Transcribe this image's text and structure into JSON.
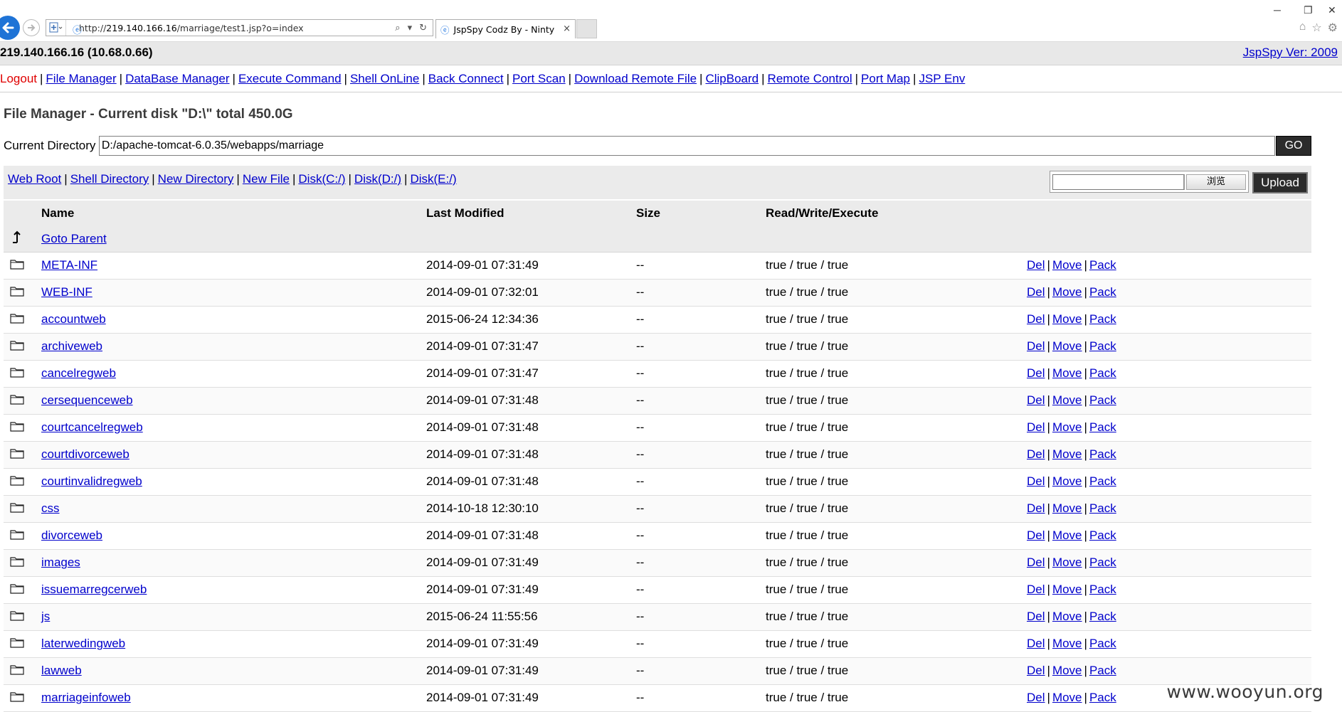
{
  "browser": {
    "url_prefix": "http://",
    "url_host": "219.140.166.16",
    "url_path": "/marriage/test1.jsp?o=index",
    "tab_title": "JspSpy Codz By - Ninty",
    "tab_close": "×"
  },
  "header": {
    "server": "219.140.166.16 (10.68.0.66)",
    "version": "JspSpy Ver: 2009"
  },
  "menu": {
    "logout": "Logout",
    "items": [
      "File Manager",
      "DataBase Manager",
      "Execute Command",
      "Shell OnLine",
      "Back Connect",
      "Port Scan",
      "Download Remote File",
      "ClipBoard",
      "Remote Control",
      "Port Map",
      "JSP Env"
    ]
  },
  "title": "File Manager - Current disk \"D:\\\" total 450.0G",
  "current_directory": {
    "label": "Current Directory",
    "value": "D:/apache-tomcat-6.0.35/webapps/marriage",
    "go_label": "GO"
  },
  "toolbar": {
    "links": [
      "Web Root",
      "Shell Directory",
      "New Directory",
      "New File",
      "Disk(C:/)",
      "Disk(D:/)",
      "Disk(E:/)"
    ],
    "browse_label": "浏览",
    "upload_label": "Upload"
  },
  "table": {
    "headers": {
      "name": "Name",
      "modified": "Last Modified",
      "size": "Size",
      "rwe": "Read/Write/Execute"
    },
    "parent_label": "Goto Parent",
    "actions": [
      "Del",
      "Move",
      "Pack"
    ],
    "rows": [
      {
        "name": "META-INF",
        "modified": "2014-09-01 07:31:49",
        "size": "--",
        "rwe": "true / true / true"
      },
      {
        "name": "WEB-INF",
        "modified": "2014-09-01 07:32:01",
        "size": "--",
        "rwe": "true / true / true"
      },
      {
        "name": "accountweb",
        "modified": "2015-06-24 12:34:36",
        "size": "--",
        "rwe": "true / true / true"
      },
      {
        "name": "archiveweb",
        "modified": "2014-09-01 07:31:47",
        "size": "--",
        "rwe": "true / true / true"
      },
      {
        "name": "cancelregweb",
        "modified": "2014-09-01 07:31:47",
        "size": "--",
        "rwe": "true / true / true"
      },
      {
        "name": "cersequenceweb",
        "modified": "2014-09-01 07:31:48",
        "size": "--",
        "rwe": "true / true / true"
      },
      {
        "name": "courtcancelregweb",
        "modified": "2014-09-01 07:31:48",
        "size": "--",
        "rwe": "true / true / true"
      },
      {
        "name": "courtdivorceweb",
        "modified": "2014-09-01 07:31:48",
        "size": "--",
        "rwe": "true / true / true"
      },
      {
        "name": "courtinvalidregweb",
        "modified": "2014-09-01 07:31:48",
        "size": "--",
        "rwe": "true / true / true"
      },
      {
        "name": "css",
        "modified": "2014-10-18 12:30:10",
        "size": "--",
        "rwe": "true / true / true"
      },
      {
        "name": "divorceweb",
        "modified": "2014-09-01 07:31:48",
        "size": "--",
        "rwe": "true / true / true"
      },
      {
        "name": "images",
        "modified": "2014-09-01 07:31:49",
        "size": "--",
        "rwe": "true / true / true"
      },
      {
        "name": "issuemarregcerweb",
        "modified": "2014-09-01 07:31:49",
        "size": "--",
        "rwe": "true / true / true"
      },
      {
        "name": "js",
        "modified": "2015-06-24 11:55:56",
        "size": "--",
        "rwe": "true / true / true"
      },
      {
        "name": "laterwedingweb",
        "modified": "2014-09-01 07:31:49",
        "size": "--",
        "rwe": "true / true / true"
      },
      {
        "name": "lawweb",
        "modified": "2014-09-01 07:31:49",
        "size": "--",
        "rwe": "true / true / true"
      },
      {
        "name": "marriageinfoweb",
        "modified": "2014-09-01 07:31:49",
        "size": "--",
        "rwe": "true / true / true"
      }
    ]
  },
  "watermark": "www.wooyun.org",
  "colors": {
    "link": "#0000cc",
    "logout": "#e00000",
    "header_bg": "#e8e8e8",
    "button_dark": "#2b2b2b"
  }
}
